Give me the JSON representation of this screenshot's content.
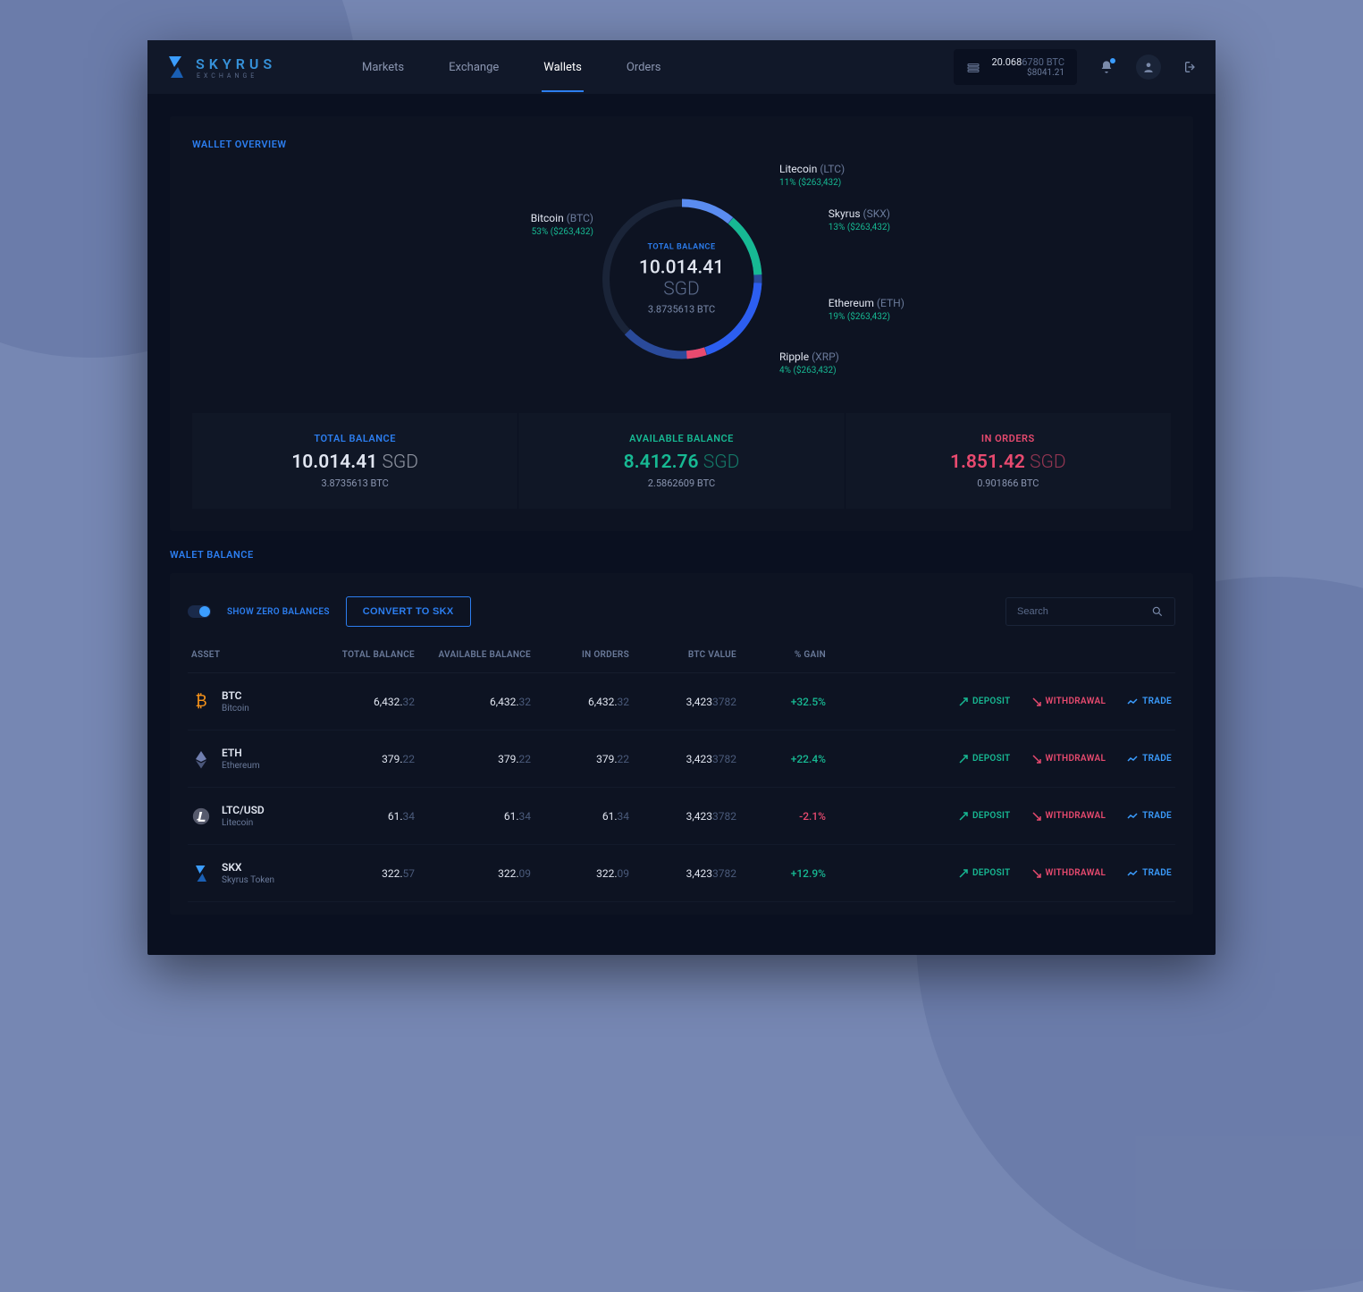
{
  "brand": {
    "name": "SKYRUS",
    "sub": "EXCHANGE"
  },
  "nav": {
    "items": [
      "Markets",
      "Exchange",
      "Wallets",
      "Orders"
    ],
    "activeIndex": 2
  },
  "header_balance": {
    "major": "20.068",
    "minor": "6780 BTC",
    "usd": "$8041.21"
  },
  "overview": {
    "title": "WALLET OVERVIEW",
    "center_label": "TOTAL BALANCE",
    "center_value": "10.014.41",
    "center_currency": "SGD",
    "center_sub": "3.8735613 BTC",
    "slices": [
      {
        "name": "Bitcoin",
        "sym": "(BTC)",
        "pct": "53%",
        "amt": "($263,432)"
      },
      {
        "name": "Litecoin",
        "sym": "(LTC)",
        "pct": "11%",
        "amt": "($263,432)"
      },
      {
        "name": "Skyrus",
        "sym": "(SKX)",
        "pct": "13%",
        "amt": "($263,432)"
      },
      {
        "name": "Ethereum",
        "sym": "(ETH)",
        "pct": "19%",
        "amt": "($263,432)"
      },
      {
        "name": "Ripple",
        "sym": "(XRP)",
        "pct": "4%",
        "amt": "($263,432)"
      }
    ],
    "stats": [
      {
        "label": "TOTAL BALANCE",
        "value": "10.014.41",
        "currency": "SGD",
        "sub": "3.8735613 BTC",
        "color": "blue"
      },
      {
        "label": "AVAILABLE BALANCE",
        "value": "8.412.76",
        "currency": "SGD",
        "sub": "2.5862609 BTC",
        "color": "green"
      },
      {
        "label": "IN ORDERS",
        "value": "1.851.42",
        "currency": "SGD",
        "sub": "0.901866 BTC",
        "color": "red"
      }
    ]
  },
  "chart_data": {
    "type": "pie",
    "title": "TOTAL BALANCE",
    "series": [
      {
        "name": "Bitcoin (BTC)",
        "value": 53,
        "usd": 263432
      },
      {
        "name": "Litecoin (LTC)",
        "value": 11,
        "usd": 263432
      },
      {
        "name": "Skyrus (SKX)",
        "value": 13,
        "usd": 263432
      },
      {
        "name": "Ethereum (ETH)",
        "value": 19,
        "usd": 263432
      },
      {
        "name": "Ripple (XRP)",
        "value": 4,
        "usd": 263432
      }
    ],
    "center_text": "10.014.41 SGD",
    "center_sub": "3.8735613 BTC"
  },
  "balances": {
    "title": "WALET BALANCE",
    "toggle_label": "SHOW ZERO BALANCES",
    "convert_label": "CONVERT TO SKX",
    "search_placeholder": "Search",
    "columns": [
      "ASSET",
      "TOTAL BALANCE",
      "AVAILABLE BALANCE",
      "IN ORDERS",
      "BTC VALUE",
      "% GAIN"
    ],
    "action_labels": {
      "deposit": "DEPOSIT",
      "withdrawal": "WITHDRAWAL",
      "trade": "TRADE"
    },
    "rows": [
      {
        "sym": "BTC",
        "name": "Bitcoin",
        "total": "6,432.",
        "total_d": "32",
        "avail": "6,432.",
        "avail_d": "32",
        "ord": "6,432.",
        "ord_d": "32",
        "btc": "3,423",
        "btc_d": "3782",
        "gain": "+32.5%",
        "gain_dir": "pos",
        "icon": "btc"
      },
      {
        "sym": "ETH",
        "name": "Ethereum",
        "total": "379.",
        "total_d": "22",
        "avail": "379.",
        "avail_d": "22",
        "ord": "379.",
        "ord_d": "22",
        "btc": "3,423",
        "btc_d": "3782",
        "gain": "+22.4%",
        "gain_dir": "pos",
        "icon": "eth"
      },
      {
        "sym": "LTC/USD",
        "name": "Litecoin",
        "total": "61.",
        "total_d": "34",
        "avail": "61.",
        "avail_d": "34",
        "ord": "61.",
        "ord_d": "34",
        "btc": "3,423",
        "btc_d": "3782",
        "gain": "-2.1%",
        "gain_dir": "neg",
        "icon": "ltc"
      },
      {
        "sym": "SKX",
        "name": "Skyrus Token",
        "total": "322.",
        "total_d": "57",
        "avail": "322.",
        "avail_d": "09",
        "ord": "322.",
        "ord_d": "09",
        "btc": "3,423",
        "btc_d": "3782",
        "gain": "+12.9%",
        "gain_dir": "pos",
        "icon": "skx"
      }
    ]
  }
}
